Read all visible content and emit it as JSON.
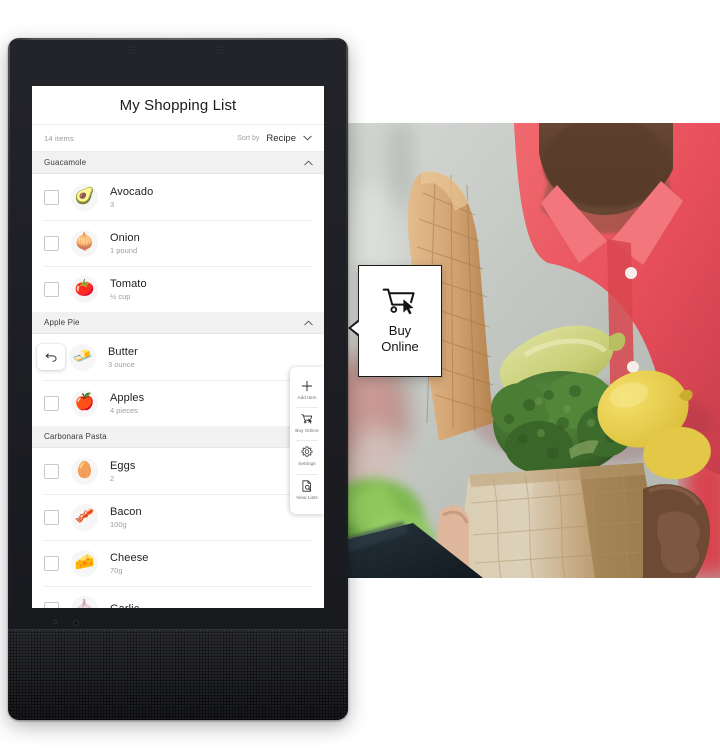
{
  "app": {
    "title": "My Shopping List",
    "item_count": "14 items",
    "sort": {
      "label": "Sort by",
      "value": "Recipe",
      "chevron_icon": "chevron-down-icon"
    }
  },
  "groups": [
    {
      "name": "Guacamole",
      "chevron_icon": "chevron-up-icon",
      "items": [
        {
          "name": "Avocado",
          "qty": "3",
          "emoji": "🥑",
          "checked": false,
          "state": "normal"
        },
        {
          "name": "Onion",
          "qty": "1 pound",
          "emoji": "🧅",
          "checked": false,
          "state": "normal"
        },
        {
          "name": "Tomato",
          "qty": "½ cup",
          "emoji": "🍅",
          "checked": false,
          "state": "normal"
        }
      ]
    },
    {
      "name": "Apple Pie",
      "chevron_icon": "chevron-up-icon",
      "items": [
        {
          "name": "Butter",
          "qty": "3 ounce",
          "emoji": "🧈",
          "checked": true,
          "state": "undo"
        },
        {
          "name": "Apples",
          "qty": "4 pieces",
          "emoji": "🍎",
          "checked": false,
          "state": "normal"
        }
      ]
    },
    {
      "name": "Carbonara Pasta",
      "chevron_icon": "chevron-up-icon",
      "items": [
        {
          "name": "Eggs",
          "qty": "2",
          "emoji": "🥚",
          "checked": false,
          "state": "normal"
        },
        {
          "name": "Bacon",
          "qty": "100g",
          "emoji": "🥓",
          "checked": false,
          "state": "normal"
        },
        {
          "name": "Cheese",
          "qty": "70g",
          "emoji": "🧀",
          "checked": false,
          "state": "normal"
        },
        {
          "name": "Garlic",
          "qty": "",
          "emoji": "🧄",
          "checked": false,
          "state": "normal"
        }
      ]
    }
  ],
  "rail": {
    "buttons": [
      {
        "icon": "plus-icon",
        "label": "Add\nItem"
      },
      {
        "icon": "cart-cursor-icon",
        "label": "Buy\nOnline"
      },
      {
        "icon": "gear-icon",
        "label": "Settings"
      },
      {
        "icon": "document-search-icon",
        "label": "View\nLists"
      }
    ]
  },
  "callout": {
    "icon": "cart-cursor-icon",
    "line1": "Buy",
    "line2": "Online"
  },
  "photo": {
    "description": "Person in coral polo shirt holding a brown paper grocery bag with baguette, broccoli, lemon and squash",
    "colors": {
      "shirt": "#e8505b",
      "bag": "#c4a882",
      "broccoli": "#3f6e2e",
      "lemon": "#e8cf4e",
      "baguette": "#d9ab79",
      "background": "#c8cbc6",
      "foliage": "#79b84a",
      "dark_clothing": "#1e2a33"
    }
  }
}
